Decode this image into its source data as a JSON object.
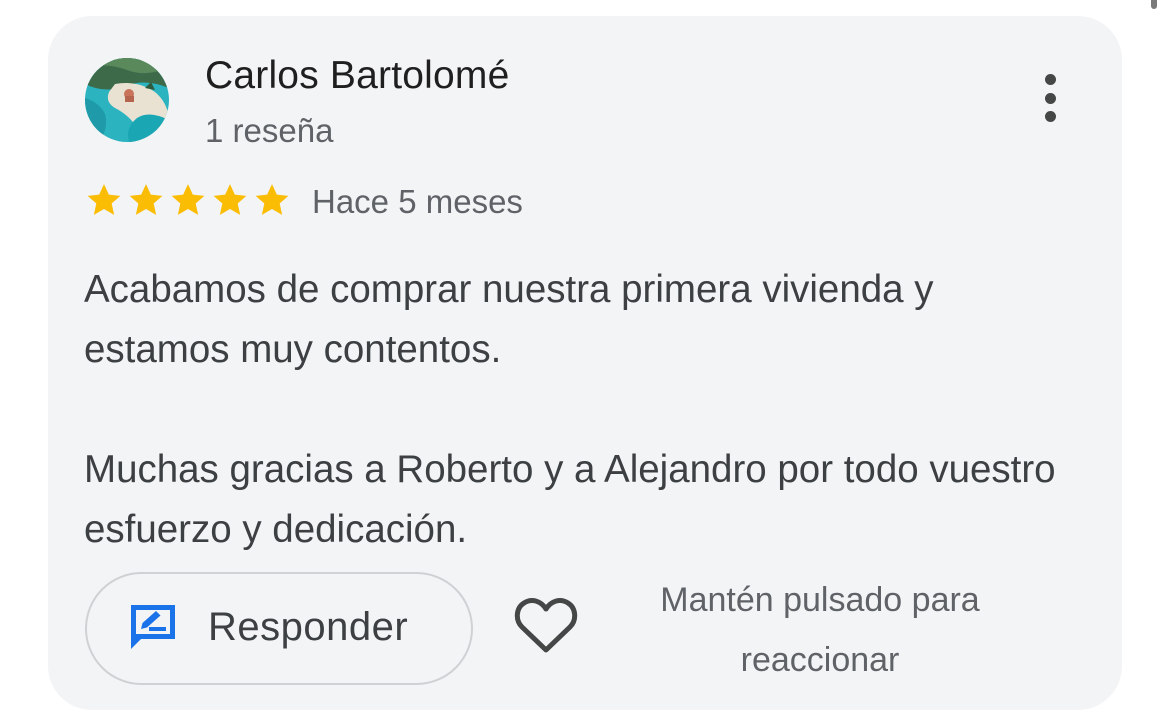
{
  "review": {
    "author_name": "Carlos Bartolomé",
    "review_count": "1 reseña",
    "rating": 5,
    "rating_max": 5,
    "date": "Hace 5 meses",
    "paragraphs": [
      "Acabamos de comprar nuestra primera vivienda y estamos muy contentos.",
      "Muchas gracias a Roberto y a Alejandro por todo vuestro esfuerzo y dedicación."
    ],
    "star_color": "#fbbc04",
    "avatar_icon": "beach-photo-avatar",
    "more_icon": "more-vert-icon"
  },
  "actions": {
    "reply_label": "Responder",
    "reply_icon": "edit-reply-icon",
    "reply_icon_color": "#1a73e8",
    "heart_icon": "heart-outline-icon",
    "react_hint": "Mantén pulsado para reaccionar"
  }
}
